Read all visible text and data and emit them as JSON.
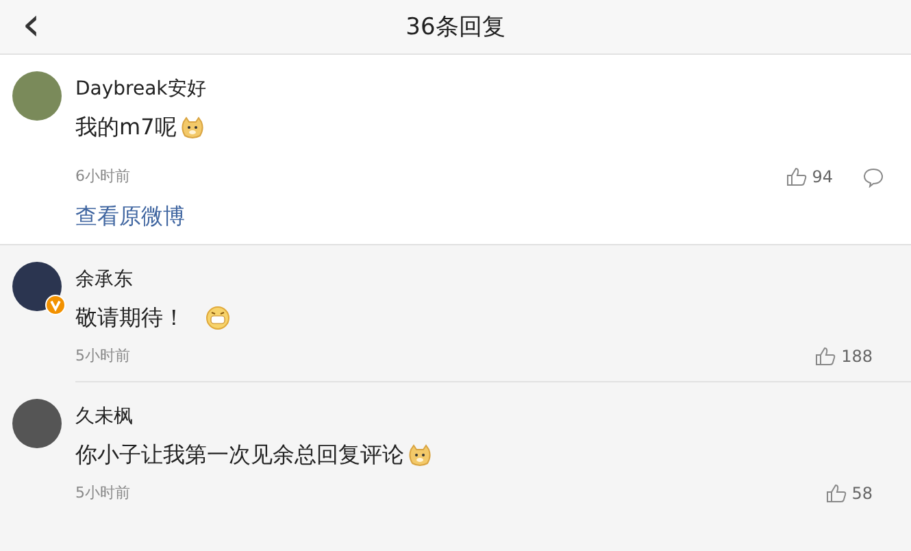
{
  "header": {
    "back": "‹",
    "title": "36条回复"
  },
  "comments": [
    {
      "kind": "main",
      "name": "Daybreak安好",
      "verified": false,
      "text": "我的m7呢",
      "emoji": {
        "kind": "doge"
      },
      "time": "6小时前",
      "likes": "94",
      "comment_button": true,
      "link": "查看原微博"
    },
    {
      "kind": "reply",
      "name": "余承东",
      "verified": true,
      "text": "敬请期待！",
      "emoji": {
        "kind": "grin"
      },
      "time": "5小时前",
      "likes": "188",
      "comment_button": false
    },
    {
      "kind": "reply",
      "name": "久未枫",
      "verified": false,
      "text": "你小子让我第一次见余总回复评论",
      "emoji": {
        "kind": "doge"
      },
      "time": "5小时前",
      "likes": "58",
      "comment_button": false
    }
  ]
}
